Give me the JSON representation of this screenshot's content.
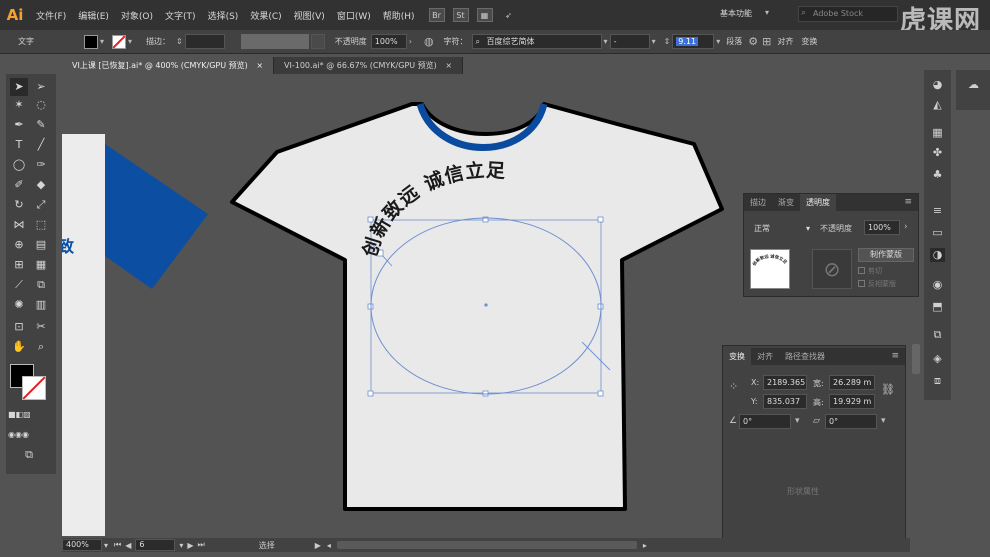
{
  "app": {
    "logo": "Ai",
    "menu": [
      "文件(F)",
      "编辑(E)",
      "对象(O)",
      "文字(T)",
      "选择(S)",
      "效果(C)",
      "视图(V)",
      "窗口(W)",
      "帮助(H)"
    ],
    "bar_icons": [
      "Br",
      "St"
    ],
    "workspace": "基本功能",
    "search_placeholder": "Adobe Stock",
    "watermark": "虎课网"
  },
  "control_bar": {
    "selection_label": "文字",
    "stroke_label": "描边：",
    "opacity_label": "不透明度",
    "opacity_value": "100%",
    "char_label": "字符：",
    "font_name": "百度综艺简体",
    "font_size": "9.11",
    "para_label": "段落",
    "align_label": "对齐",
    "transform_label": "变换"
  },
  "tabs": [
    {
      "label": "VI上课 [已恢复].ai* @ 400% (CMYK/GPU 预览)",
      "active": true
    },
    {
      "label": "VI-100.ai* @ 66.67% (CMYK/GPU 预览)",
      "active": false
    }
  ],
  "artwork": {
    "arc_text": "创新致远 诚信立足",
    "shirt_color": "#e9e9e9",
    "collar_color": "#0a4a9f",
    "sleeve_color": "#0b4ea2",
    "path_color": "#6f8fd0"
  },
  "transparency_panel": {
    "tabs": [
      "描边",
      "渐变",
      "透明度"
    ],
    "active_tab": "透明度",
    "blend_mode": "正常",
    "opacity_label": "不透明度",
    "opacity_value": "100%",
    "make_mask_button": "制作蒙版",
    "clip_label": "剪切",
    "invert_label": "反相蒙版",
    "thumb_text": "创新致远 诚信立足"
  },
  "transform_panel": {
    "tabs": [
      "变换",
      "对齐",
      "路径查找器"
    ],
    "active_tab": "变换",
    "x_label": "X:",
    "x_value": "2189.365",
    "y_label": "Y:",
    "y_value": "835.037",
    "w_label": "宽:",
    "w_value": "26.289 m",
    "h_label": "高:",
    "h_value": "19.929 m",
    "rotate_value": "0°",
    "shear_value": "0°",
    "footer_text": "形状属性"
  },
  "status_bar": {
    "zoom": "400%",
    "page": "6",
    "mode": "选择"
  }
}
